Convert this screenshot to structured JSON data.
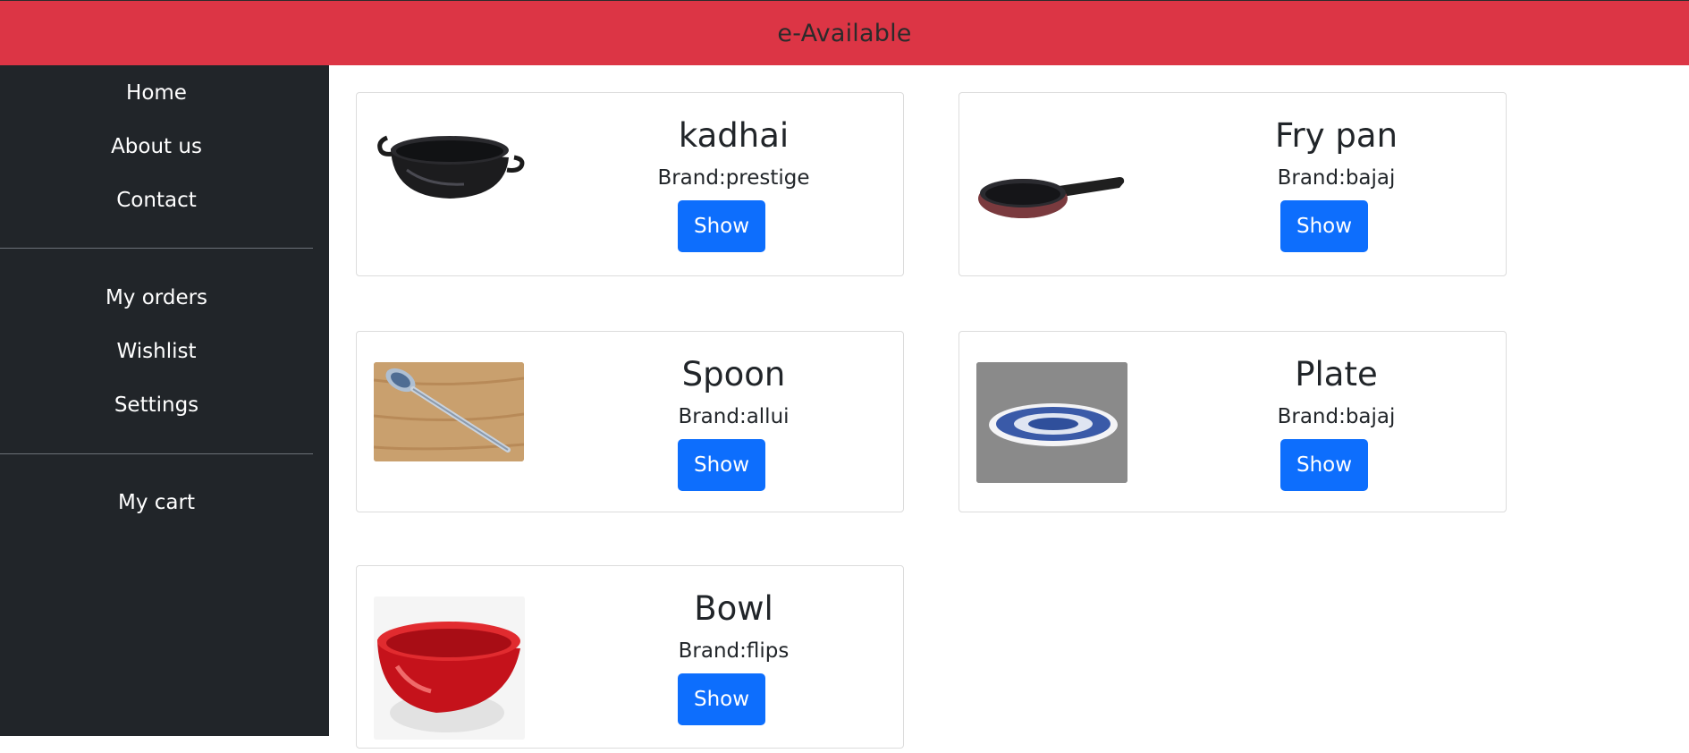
{
  "header": {
    "brand": "e-Available"
  },
  "sidebar": {
    "items": [
      {
        "label": "Home"
      },
      {
        "label": "About us"
      },
      {
        "label": "Contact"
      },
      {
        "label": "My orders"
      },
      {
        "label": "Wishlist"
      },
      {
        "label": "Settings"
      },
      {
        "label": "My cart"
      }
    ]
  },
  "products": [
    {
      "name": "kadhai",
      "brand": "Brand:prestige",
      "button": "Show",
      "image": "kadhai-image"
    },
    {
      "name": "Fry pan",
      "brand": "Brand:bajaj",
      "button": "Show",
      "image": "fry-pan-image"
    },
    {
      "name": "Spoon",
      "brand": "Brand:allui",
      "button": "Show",
      "image": "spoon-image"
    },
    {
      "name": "Plate",
      "brand": "Brand:bajaj",
      "button": "Show",
      "image": "plate-image"
    },
    {
      "name": "Bowl",
      "brand": "Brand:flips",
      "button": "Show",
      "image": "bowl-image"
    }
  ],
  "colors": {
    "header_bg": "#dc3545",
    "sidebar_bg": "#212529",
    "button_bg": "#0d6efd"
  }
}
